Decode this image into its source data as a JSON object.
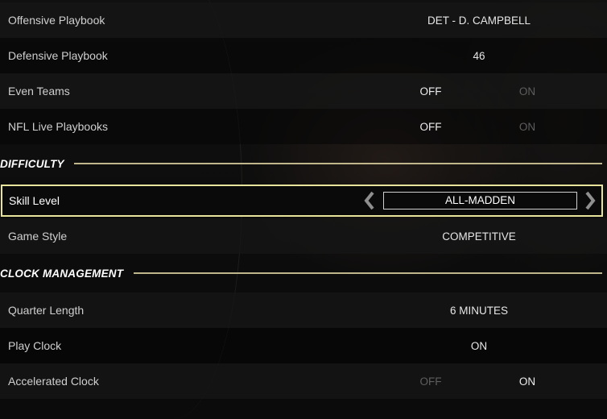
{
  "settings_top": [
    {
      "label": "Offensive Playbook",
      "value": "DET - D. CAMPBELL"
    },
    {
      "label": "Defensive Playbook",
      "value": "46"
    }
  ],
  "even_teams": {
    "label": "Even Teams",
    "off": "OFF",
    "on": "ON",
    "selected": "OFF"
  },
  "nfl_live_playbooks": {
    "label": "NFL Live Playbooks",
    "off": "OFF",
    "on": "ON",
    "selected": "OFF"
  },
  "difficulty": {
    "title": "DIFFICULTY",
    "skill_level": {
      "label": "Skill Level",
      "value": "ALL-MADDEN",
      "left_icon": "chevron-left-icon",
      "right_icon": "chevron-right-icon"
    },
    "game_style": {
      "label": "Game Style",
      "value": "COMPETITIVE"
    }
  },
  "clock_management": {
    "title": "CLOCK MANAGEMENT",
    "quarter_length": {
      "label": "Quarter Length",
      "value": "6 MINUTES"
    },
    "play_clock": {
      "label": "Play Clock",
      "value": "ON"
    },
    "accelerated_clock": {
      "label": "Accelerated Clock",
      "off": "OFF",
      "on": "ON",
      "selected": "ON"
    }
  },
  "colors": {
    "highlight_border": "#e7e39a",
    "section_rule": "#bfb68c",
    "inactive_option": "#5e5e5e"
  }
}
